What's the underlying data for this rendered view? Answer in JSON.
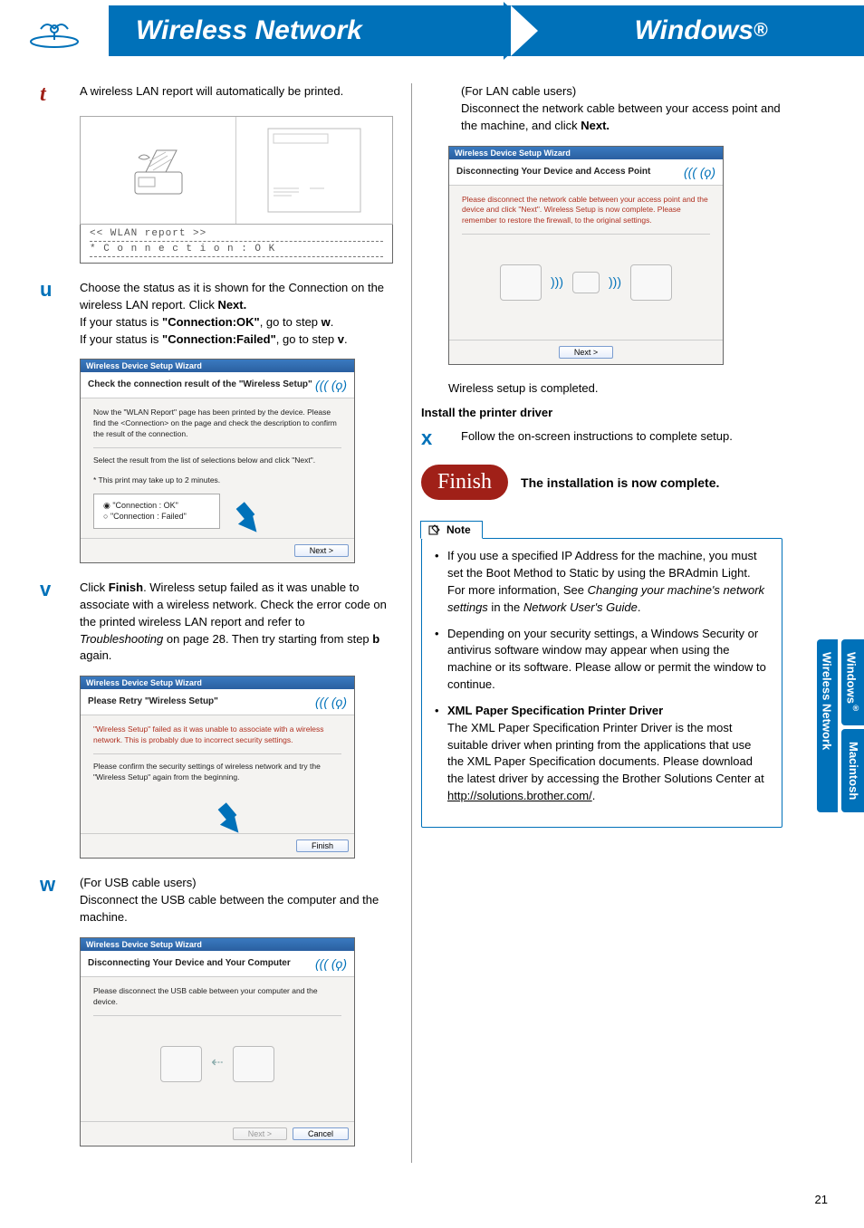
{
  "header": {
    "left_title": "Wireless Network",
    "right_title": "Windows",
    "right_title_suffix": "®"
  },
  "left": {
    "t": {
      "letter": "t",
      "body": "A wireless LAN report will automatically be printed."
    },
    "wlan_report": {
      "title": "<<  WLAN report  >>",
      "line": "*   C o n n e c t i o n  :  O K"
    },
    "u": {
      "letter": "u",
      "l1": "Choose the status as it is shown for the Connection on the wireless LAN report. Click ",
      "l1b": "Next.",
      "l2a": "If your status is ",
      "l2b": "\"Connection:OK\"",
      "l2c": ", go to step ",
      "l2d": "w",
      "l2e": ".",
      "l3a": "If your status is ",
      "l3b": "\"Connection:Failed\"",
      "l3c": ", go to step ",
      "l3d": "v",
      "l3e": "."
    },
    "wizard_u": {
      "titlebar": "Wireless Device Setup Wizard",
      "heading": "Check the connection result of the \"Wireless Setup\"",
      "body1": "Now the \"WLAN Report\" page has been printed by the device. Please find the <Connection> on the page and check the description to confirm the result of the connection.",
      "body2": "Select the result from the list of selections below and click \"Next\".",
      "body3": "* This print may take up to 2 minutes.",
      "radio1": "\"Connection : OK\"",
      "radio2": "\"Connection : Failed\"",
      "btn_next": "Next >"
    },
    "v": {
      "letter": "v",
      "p1a": "Click ",
      "p1b": "Finish",
      "p1c": ". Wireless setup failed as it was unable to associate with a wireless network. Check the error code on the printed wireless LAN report and refer to ",
      "p1d": "Troubleshooting",
      "p1e": " on page 28. Then try starting from step ",
      "p1f": "b",
      "p1g": " again."
    },
    "wizard_v": {
      "titlebar": "Wireless Device Setup Wizard",
      "heading": "Please Retry \"Wireless Setup\"",
      "body1": "\"Wireless Setup\" failed as it was unable to associate with a wireless network. This is probably due to incorrect security settings.",
      "body2": "Please confirm the security settings of wireless network and try the \"Wireless Setup\" again from the beginning.",
      "btn_finish": "Finish"
    },
    "w": {
      "letter": "w",
      "l1": "(For USB cable users)",
      "l2": "Disconnect the USB cable between the computer and the machine."
    },
    "wizard_w": {
      "titlebar": "Wireless Device Setup Wizard",
      "heading": "Disconnecting Your Device and Your Computer",
      "body1": "Please disconnect the USB cable between your computer and the device.",
      "btn_next": "Next >",
      "btn_cancel": "Cancel"
    }
  },
  "right": {
    "lan_users": "(For LAN cable users)",
    "lan_body_a": "Disconnect the network cable between your access point and the machine, and click ",
    "lan_body_b": "Next.",
    "wizard_r": {
      "titlebar": "Wireless Device Setup Wizard",
      "heading": "Disconnecting Your Device and Access Point",
      "body1": "Please disconnect the network cable between your access point and the device and click \"Next\". Wireless Setup is now complete. Please remember to restore the firewall, to the original settings.",
      "btn_next": "Next >"
    },
    "completed": "Wireless setup is completed.",
    "install_heading": "Install the printer driver",
    "x": {
      "letter": "x",
      "body": "Follow the on-screen instructions to complete setup."
    },
    "finish": {
      "pill": "Finish",
      "text": "The installation is now complete."
    },
    "note": {
      "label": "Note",
      "b1a": "If you use a specified IP Address for the machine, you must set the Boot Method to Static by using the BRAdmin Light. For more information, See ",
      "b1b": "Changing your machine's network settings",
      "b1c": " in the ",
      "b1d": "Network User's Guide",
      "b1e": ".",
      "b2": "Depending on your security settings, a Windows Security or antivirus software window may appear when using the machine or its software. Please allow or permit the window to continue.",
      "b3a": "XML Paper Specification Printer Driver",
      "b3b": "The XML Paper Specification Printer Driver is the most suitable driver when printing from the applications that use the XML Paper Specification documents. Please download the latest driver by accessing the Brother Solutions Center at ",
      "b3c": "http://solutions.brother.com/",
      "b3d": "."
    }
  },
  "side_tabs": {
    "wn": "Wireless Network",
    "win": "Windows",
    "win_suffix": "®",
    "mac": "Macintosh"
  },
  "page_number": "21"
}
